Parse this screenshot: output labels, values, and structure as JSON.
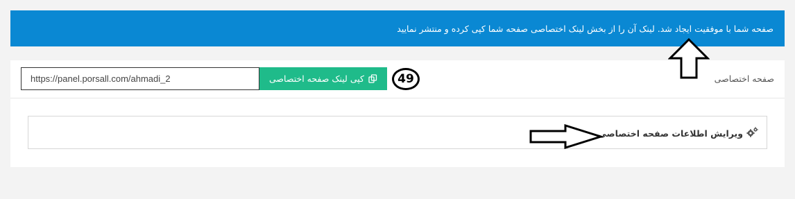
{
  "alert": {
    "message": "صفحه شما با موفقیت ایجاد شد. لینک آن را از بخش لینک اختصاصی صفحه شما کپی کرده و منتشر نمایید"
  },
  "dedicated_page": {
    "label": "صفحه اختصاصی",
    "url_value": "https://panel.porsall.com/ahmadi_2",
    "copy_button_label": "کپی لینک صفحه اختصاصی",
    "copy_icon": "copy-icon"
  },
  "step_badge": {
    "number": "49"
  },
  "edit_section": {
    "title": "ویرایش اطلاعات صفحه اختصاصی",
    "icon": "gears-icon"
  },
  "annotations": {
    "arrow_up_icon": "arrow-up-icon",
    "arrow_right_icon": "arrow-right-icon"
  }
}
